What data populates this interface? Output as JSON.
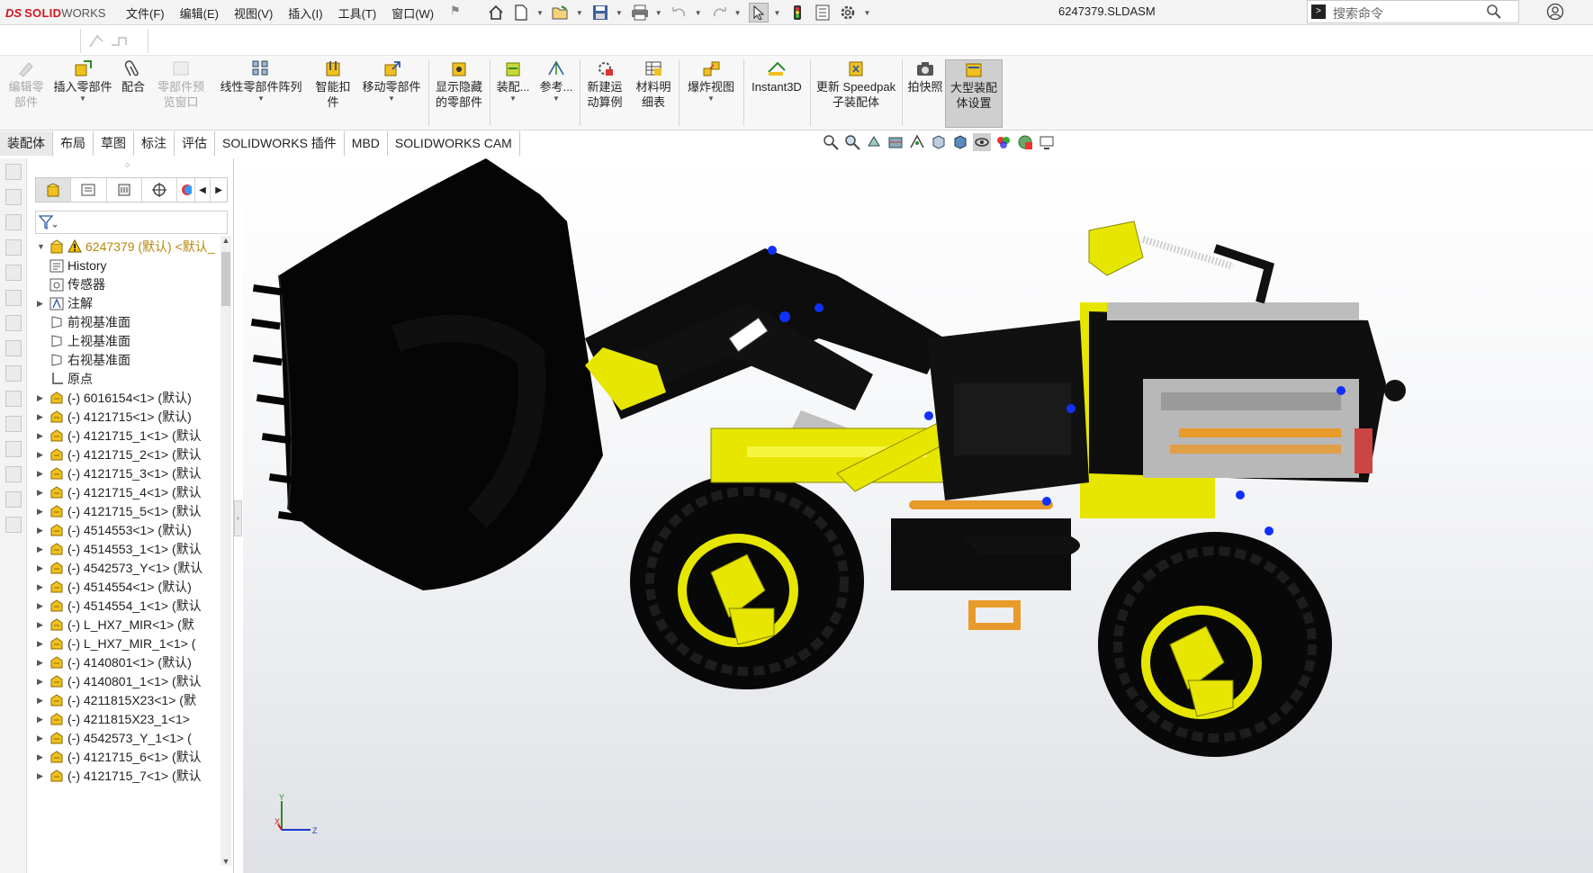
{
  "app": {
    "logo_ds": "DS",
    "logo_brand_bold": "SOLID",
    "logo_brand_light": "WORKS",
    "document_title": "6247379.SLDASM",
    "accent_color": "#d0181f"
  },
  "menu": [
    "文件(F)",
    "编辑(E)",
    "视图(V)",
    "插入(I)",
    "工具(T)",
    "窗口(W)"
  ],
  "quick_access_icons": [
    "home-icon",
    "new-document-icon",
    "open-icon",
    "save-icon",
    "print-icon",
    "undo-icon",
    "redo-icon",
    "select-cursor-icon",
    "rebuild-traffic-light-icon",
    "file-properties-icon",
    "options-gear-icon"
  ],
  "search": {
    "placeholder": "搜索命令"
  },
  "ribbon": {
    "edit_component": "编辑零部件",
    "insert_component": "插入零部件",
    "mate": "配合",
    "component_preview": "零部件预览窗口",
    "linear_pattern": "线性零部件阵列",
    "smart_fasteners": "智能扣件",
    "move_component": "移动零部件",
    "show_hidden": "显示隐藏的零部件",
    "assembly_features": "装配...",
    "reference": "参考...",
    "new_motion_study": "新建运动算例",
    "bom": "材料明细表",
    "exploded_view": "爆炸视图",
    "instant3d": "Instant3D",
    "update_speedpak": "更新 Speedpak子装配体",
    "snapshot": "拍快照",
    "large_assembly": "大型装配体设置"
  },
  "tabs": [
    "装配体",
    "布局",
    "草图",
    "标注",
    "评估",
    "SOLIDWORKS 插件",
    "MBD",
    "SOLIDWORKS CAM"
  ],
  "active_tab": "装配体",
  "feature_tree": {
    "root": "6247379 (默认) <默认_",
    "items": [
      {
        "label": "History",
        "icon": "history-icon",
        "expandable": false
      },
      {
        "label": "传感器",
        "icon": "sensor-icon",
        "expandable": false
      },
      {
        "label": "注解",
        "icon": "annotation-icon",
        "expandable": true
      },
      {
        "label": "前视基准面",
        "icon": "plane-icon",
        "expandable": false
      },
      {
        "label": "上视基准面",
        "icon": "plane-icon",
        "expandable": false
      },
      {
        "label": "右视基准面",
        "icon": "plane-icon",
        "expandable": false
      },
      {
        "label": "原点",
        "icon": "origin-icon",
        "expandable": false
      },
      {
        "label": "(-) 6016154<1> (默认)",
        "icon": "part-icon",
        "expandable": true
      },
      {
        "label": "(-) 4121715<1> (默认)",
        "icon": "part-icon",
        "expandable": true
      },
      {
        "label": "(-) 4121715_1<1> (默认",
        "icon": "part-icon",
        "expandable": true
      },
      {
        "label": "(-) 4121715_2<1> (默认",
        "icon": "part-icon",
        "expandable": true
      },
      {
        "label": "(-) 4121715_3<1> (默认",
        "icon": "part-icon",
        "expandable": true
      },
      {
        "label": "(-) 4121715_4<1> (默认",
        "icon": "part-icon",
        "expandable": true
      },
      {
        "label": "(-) 4121715_5<1> (默认",
        "icon": "part-icon",
        "expandable": true
      },
      {
        "label": "(-) 4514553<1> (默认)",
        "icon": "part-icon",
        "expandable": true
      },
      {
        "label": "(-) 4514553_1<1> (默认",
        "icon": "part-icon",
        "expandable": true
      },
      {
        "label": "(-) 4542573_Y<1> (默认",
        "icon": "part-icon",
        "expandable": true
      },
      {
        "label": "(-) 4514554<1> (默认)",
        "icon": "part-icon",
        "expandable": true
      },
      {
        "label": "(-) 4514554_1<1> (默认",
        "icon": "part-icon",
        "expandable": true
      },
      {
        "label": "(-) L_HX7_MIR<1> (默",
        "icon": "part-icon",
        "expandable": true
      },
      {
        "label": "(-) L_HX7_MIR_1<1> (",
        "icon": "part-icon",
        "expandable": true
      },
      {
        "label": "(-) 4140801<1> (默认)",
        "icon": "part-icon",
        "expandable": true
      },
      {
        "label": "(-) 4140801_1<1> (默认",
        "icon": "part-icon",
        "expandable": true
      },
      {
        "label": "(-) 4211815X23<1> (默",
        "icon": "part-icon",
        "expandable": true
      },
      {
        "label": "(-) 4211815X23_1<1> ",
        "icon": "part-icon",
        "expandable": true
      },
      {
        "label": "(-) 4542573_Y_1<1> (",
        "icon": "part-icon",
        "expandable": true
      },
      {
        "label": "(-) 4121715_6<1> (默认",
        "icon": "part-icon",
        "expandable": true
      },
      {
        "label": "(-) 4121715_7<1> (默认",
        "icon": "part-icon",
        "expandable": true
      }
    ]
  },
  "triad": {
    "x": "X",
    "y": "Y",
    "z": "Z"
  },
  "colors": {
    "model_yellow": "#e6e600",
    "model_black": "#0a0a0a",
    "model_grey": "#b8b8b8",
    "model_orange": "#e89a2a"
  }
}
